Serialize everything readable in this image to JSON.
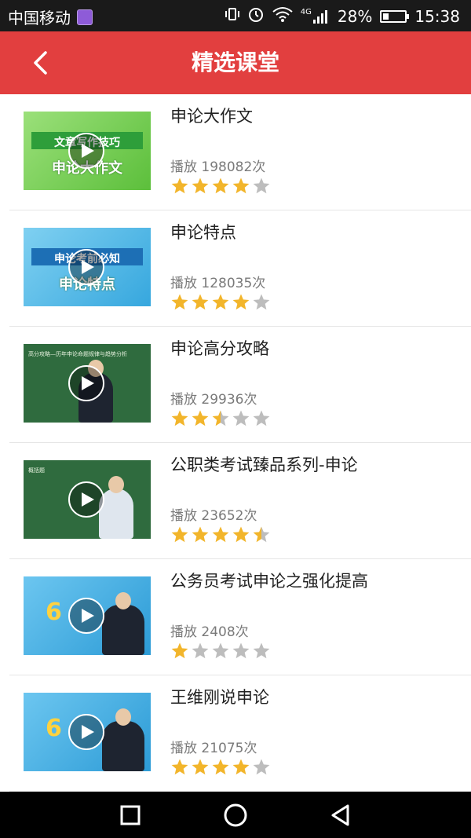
{
  "status_bar": {
    "carrier": "中国移动",
    "network": "4G",
    "battery_percent": "28%",
    "battery_level": 0.28,
    "time": "15:38",
    "icons": [
      "vibrate-icon",
      "alarm-icon",
      "wifi-icon",
      "signal-icon",
      "battery-icon"
    ]
  },
  "app_bar": {
    "title": "精选课堂",
    "back_icon": "chevron-left-icon"
  },
  "courses": [
    {
      "title": "申论大作文",
      "plays": "播放 198082次",
      "rating": 4,
      "thumb_style": "green",
      "thumb_text_top": "文章写作技巧",
      "thumb_text_main": "申论大作文"
    },
    {
      "title": "申论特点",
      "plays": "播放 128035次",
      "rating": 4,
      "thumb_style": "blue",
      "thumb_text_top": "申论考前必知",
      "thumb_text_main": "申论特点"
    },
    {
      "title": "申论高分攻略",
      "plays": "播放 29936次",
      "rating": 2.5,
      "thumb_style": "board",
      "thumb_text_top": "高分攻略—历年申论命题规律与趋势分析",
      "thumb_text_main": ""
    },
    {
      "title": "公职类考试臻品系列-申论",
      "plays": "播放 23652次",
      "rating": 4.5,
      "thumb_style": "board",
      "thumb_text_top": "概括题",
      "thumb_text_main": ""
    },
    {
      "title": "公务员考试申论之强化提高",
      "plays": "播放 2408次",
      "rating": 1,
      "thumb_style": "studio",
      "thumb_text_top": "",
      "thumb_text_main": ""
    },
    {
      "title": "王维刚说申论",
      "plays": "播放 21075次",
      "rating": 4,
      "thumb_style": "studio",
      "thumb_text_top": "",
      "thumb_text_main": ""
    }
  ],
  "colors": {
    "app_bar": "#e23f3f",
    "star_filled": "#f2b52b",
    "star_empty": "#bdbdbd",
    "status_bar": "#1a1a1a",
    "nav_bar": "#000000"
  },
  "nav_bar": {
    "icons": [
      "recent-apps-icon",
      "home-icon",
      "back-icon"
    ]
  }
}
